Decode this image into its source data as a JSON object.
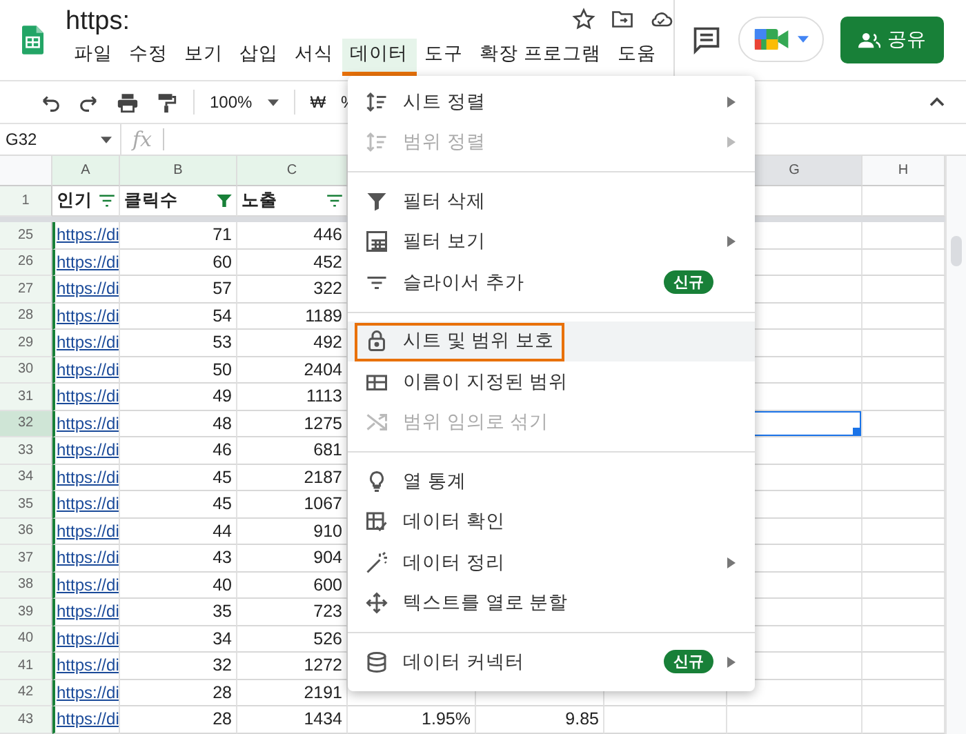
{
  "app": {
    "title": "https:",
    "share_button": "공유",
    "menus": [
      {
        "label": "파일",
        "selected": false
      },
      {
        "label": "수정",
        "selected": false
      },
      {
        "label": "보기",
        "selected": false
      },
      {
        "label": "삽입",
        "selected": false
      },
      {
        "label": "서식",
        "selected": false
      },
      {
        "label": "데이터",
        "selected": true
      },
      {
        "label": "도구",
        "selected": false
      },
      {
        "label": "확장 프로그램",
        "selected": false
      },
      {
        "label": "도움",
        "selected": false
      }
    ]
  },
  "toolbar": {
    "zoom": "100%",
    "currency": "₩",
    "percent": "%"
  },
  "formula_bar": {
    "cell_ref": "G32",
    "fx": "fx"
  },
  "columns": [
    {
      "label": "A",
      "filtered": true,
      "selected": false
    },
    {
      "label": "B",
      "filtered": true,
      "selected": false
    },
    {
      "label": "C",
      "filtered": true,
      "selected": false
    },
    {
      "label": "G",
      "filtered": false,
      "selected": true
    },
    {
      "label": "H",
      "filtered": false,
      "selected": false
    }
  ],
  "header_row": {
    "number": "1",
    "cells": [
      {
        "text": "인기",
        "filter_active": false
      },
      {
        "text": "클릭수",
        "filter_active": true
      },
      {
        "text": "노출",
        "filter_active": false
      }
    ]
  },
  "rows": [
    {
      "number": "25",
      "selected": false,
      "cells": [
        "https://di",
        "71",
        "446"
      ]
    },
    {
      "number": "26",
      "selected": false,
      "cells": [
        "https://di",
        "60",
        "452"
      ]
    },
    {
      "number": "27",
      "selected": false,
      "cells": [
        "https://di",
        "57",
        "322"
      ]
    },
    {
      "number": "28",
      "selected": false,
      "cells": [
        "https://di",
        "54",
        "1189"
      ]
    },
    {
      "number": "29",
      "selected": false,
      "cells": [
        "https://di",
        "53",
        "492"
      ]
    },
    {
      "number": "30",
      "selected": false,
      "cells": [
        "https://di",
        "50",
        "2404"
      ]
    },
    {
      "number": "31",
      "selected": false,
      "cells": [
        "https://di",
        "49",
        "1113"
      ]
    },
    {
      "number": "32",
      "selected": true,
      "cells": [
        "https://di",
        "48",
        "1275"
      ]
    },
    {
      "number": "33",
      "selected": false,
      "cells": [
        "https://di",
        "46",
        "681"
      ]
    },
    {
      "number": "34",
      "selected": false,
      "cells": [
        "https://di",
        "45",
        "2187"
      ]
    },
    {
      "number": "35",
      "selected": false,
      "cells": [
        "https://di",
        "45",
        "1067"
      ]
    },
    {
      "number": "36",
      "selected": false,
      "cells": [
        "https://di",
        "44",
        "910"
      ]
    },
    {
      "number": "37",
      "selected": false,
      "cells": [
        "https://di",
        "43",
        "904"
      ]
    },
    {
      "number": "38",
      "selected": false,
      "cells": [
        "https://di",
        "40",
        "600"
      ]
    },
    {
      "number": "39",
      "selected": false,
      "cells": [
        "https://di",
        "35",
        "723"
      ]
    },
    {
      "number": "40",
      "selected": false,
      "cells": [
        "https://di",
        "34",
        "526"
      ]
    },
    {
      "number": "41",
      "selected": false,
      "cells": [
        "https://di",
        "32",
        "1272"
      ]
    },
    {
      "number": "42",
      "selected": false,
      "cells": [
        "https://di",
        "28",
        "2191"
      ]
    },
    {
      "number": "43",
      "selected": false,
      "cells": [
        "https://di",
        "28",
        "1434",
        "1.95%",
        "9.85"
      ]
    }
  ],
  "menu": {
    "sections": [
      [
        {
          "label": "시트 정렬",
          "disabled": false,
          "submenu": true,
          "selected": false
        },
        {
          "label": "범위 정렬",
          "disabled": true,
          "submenu": true,
          "selected": false
        }
      ],
      [
        {
          "label": "필터 삭제",
          "disabled": false,
          "submenu": false,
          "selected": false
        },
        {
          "label": "필터 보기",
          "disabled": false,
          "submenu": true,
          "selected": false
        },
        {
          "label": "슬라이서 추가",
          "disabled": false,
          "submenu": false,
          "selected": false,
          "badge": "신규"
        }
      ],
      [
        {
          "label": "시트 및 범위 보호",
          "disabled": false,
          "submenu": false,
          "selected": true
        },
        {
          "label": "이름이 지정된 범위",
          "disabled": false,
          "submenu": false,
          "selected": false
        },
        {
          "label": "범위 임의로 섞기",
          "disabled": true,
          "submenu": false,
          "selected": false
        }
      ],
      [
        {
          "label": "열 통계",
          "disabled": false,
          "submenu": false,
          "selected": false
        },
        {
          "label": "데이터 확인",
          "disabled": false,
          "submenu": false,
          "selected": false
        },
        {
          "label": "데이터 정리",
          "disabled": false,
          "submenu": true,
          "selected": false
        },
        {
          "label": "텍스트를 열로 분할",
          "disabled": false,
          "submenu": false,
          "selected": false
        }
      ],
      [
        {
          "label": "데이터 커넥터",
          "disabled": false,
          "submenu": true,
          "selected": false,
          "badge": "신규"
        }
      ]
    ]
  }
}
